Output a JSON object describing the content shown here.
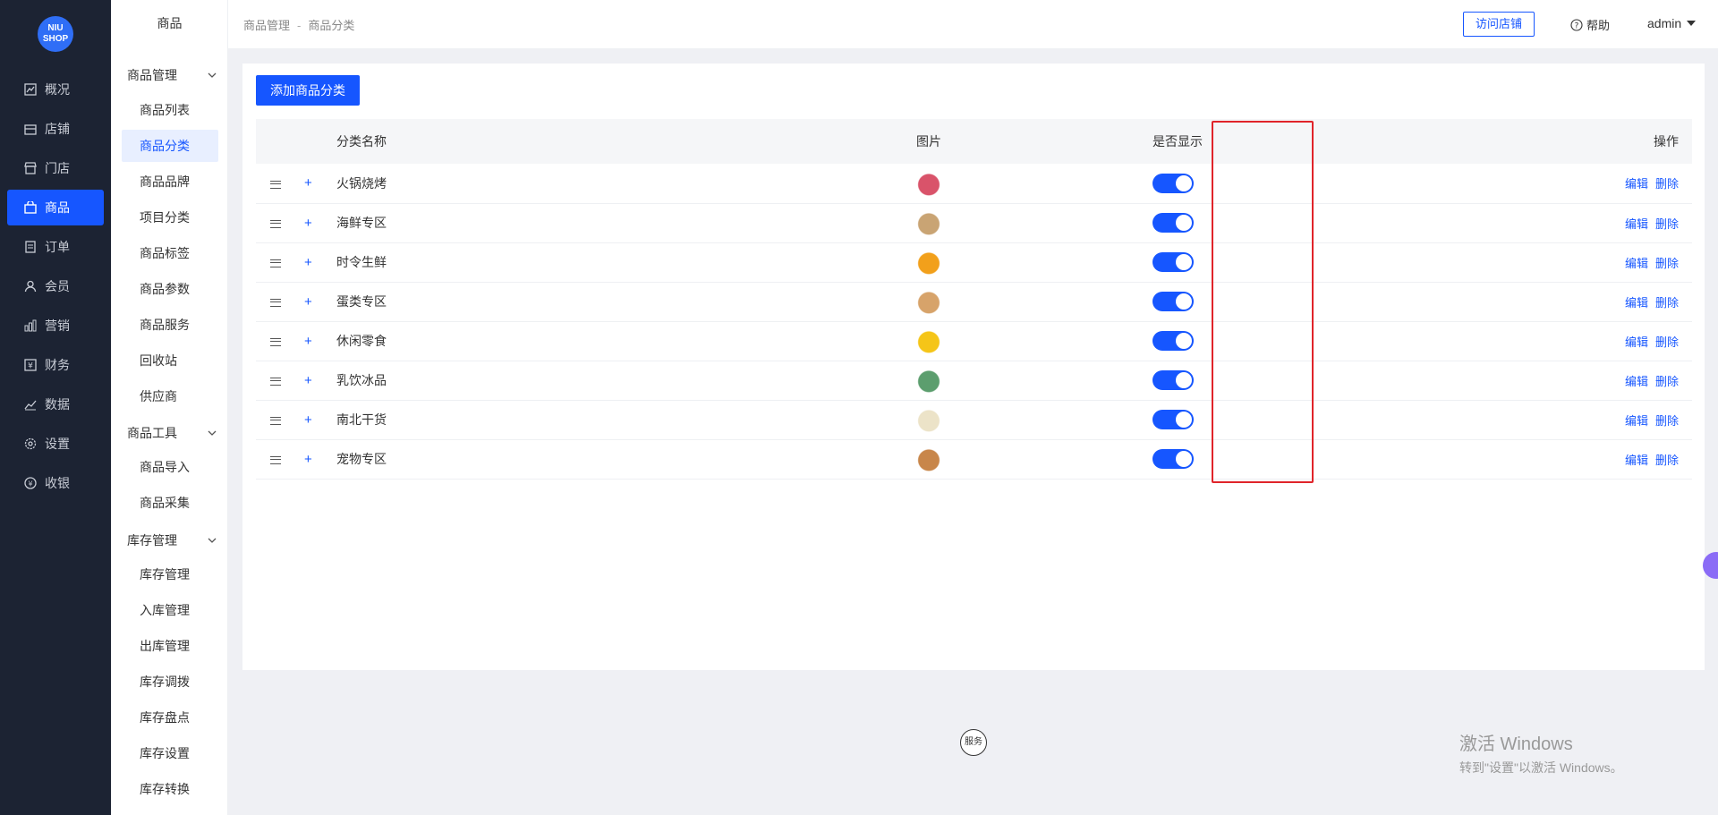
{
  "brand": {
    "logo_text_1": "NIU",
    "logo_text_2": "SHOP"
  },
  "nav": [
    {
      "label": "概况",
      "icon": "chart-line-icon"
    },
    {
      "label": "店铺",
      "icon": "store-icon"
    },
    {
      "label": "门店",
      "icon": "shop-icon"
    },
    {
      "label": "商品",
      "icon": "bag-icon",
      "active": true
    },
    {
      "label": "订单",
      "icon": "order-icon"
    },
    {
      "label": "会员",
      "icon": "user-icon"
    },
    {
      "label": "营销",
      "icon": "bar-chart-icon"
    },
    {
      "label": "财务",
      "icon": "finance-icon"
    },
    {
      "label": "数据",
      "icon": "data-icon"
    },
    {
      "label": "设置",
      "icon": "gear-icon"
    },
    {
      "label": "收银",
      "icon": "cashier-icon"
    }
  ],
  "sub": {
    "title": "商品",
    "groups": [
      {
        "label": "商品管理",
        "items": [
          "商品列表",
          "商品分类",
          "商品品牌",
          "项目分类",
          "商品标签",
          "商品参数",
          "商品服务",
          "回收站",
          "供应商"
        ]
      },
      {
        "label": "商品工具",
        "items": [
          "商品导入",
          "商品采集"
        ]
      },
      {
        "label": "库存管理",
        "items": [
          "库存管理",
          "入库管理",
          "出库管理",
          "库存调拨",
          "库存盘点",
          "库存设置",
          "库存转换"
        ]
      }
    ],
    "active_item": "商品分类"
  },
  "header": {
    "crumb_1": "商品管理",
    "crumb_sep": "-",
    "crumb_2": "商品分类",
    "visit_label": "访问店铺",
    "help_label": "帮助",
    "user_label": "admin"
  },
  "toolbar": {
    "add_label": "添加商品分类"
  },
  "table": {
    "col_name": "分类名称",
    "col_image": "图片",
    "col_show": "是否显示",
    "col_ops": "操作",
    "edit_label": "编辑",
    "delete_label": "删除",
    "rows": [
      {
        "name": "火锅烧烤",
        "show": true,
        "thumb_color": "#d9536a"
      },
      {
        "name": "海鲜专区",
        "show": true,
        "thumb_color": "#c9a474"
      },
      {
        "name": "时令生鲜",
        "show": true,
        "thumb_color": "#f2a01b"
      },
      {
        "name": "蛋类专区",
        "show": true,
        "thumb_color": "#d7a36a"
      },
      {
        "name": "休闲零食",
        "show": true,
        "thumb_color": "#f5c518"
      },
      {
        "name": "乳饮冰品",
        "show": true,
        "thumb_color": "#5c9e6e"
      },
      {
        "name": "南北干货",
        "show": true,
        "thumb_color": "#ece3c8"
      },
      {
        "name": "宠物专区",
        "show": true,
        "thumb_color": "#c8864a"
      }
    ]
  },
  "footer": {
    "service_label": "服务"
  },
  "watermark": {
    "line1": "激活 Windows",
    "line2": "转到\"设置\"以激活 Windows。"
  },
  "colors": {
    "primary": "#1656ff",
    "nav_bg": "#1c2333",
    "highlight": "#e0242a"
  }
}
